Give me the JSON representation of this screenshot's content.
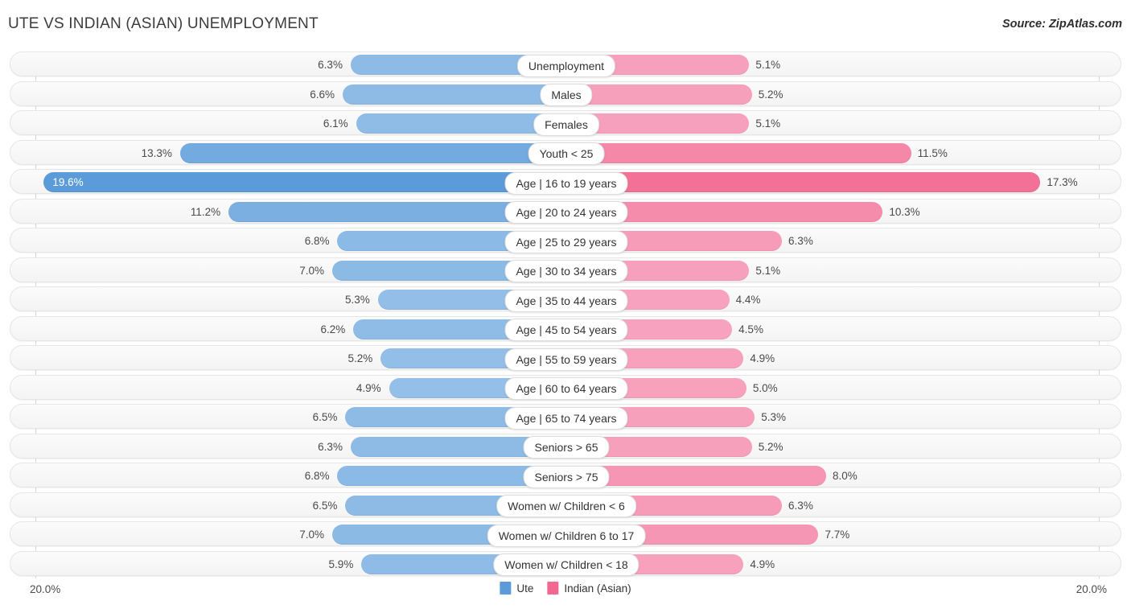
{
  "header": {
    "title": "UTE VS INDIAN (ASIAN) UNEMPLOYMENT",
    "source": "Source: ZipAtlas.com"
  },
  "axis": {
    "left_label": "20.0%",
    "right_label": "20.0%"
  },
  "legend": [
    {
      "label": "Ute",
      "color": "#5b9bd9"
    },
    {
      "label": "Indian (Asian)",
      "color": "#f2688f"
    }
  ],
  "chart_data": {
    "type": "bar",
    "title": "UTE VS INDIAN (ASIAN) UNEMPLOYMENT",
    "subtype": "diverging-bidirectional",
    "xlabel": "",
    "ylabel": "",
    "xlim": [
      20.0,
      20.0
    ],
    "grid": true,
    "legend_position": "bottom-center",
    "categories": [
      "Unemployment",
      "Males",
      "Females",
      "Youth < 25",
      "Age | 16 to 19 years",
      "Age | 20 to 24 years",
      "Age | 25 to 29 years",
      "Age | 30 to 34 years",
      "Age | 35 to 44 years",
      "Age | 45 to 54 years",
      "Age | 55 to 59 years",
      "Age | 60 to 64 years",
      "Age | 65 to 74 years",
      "Seniors > 65",
      "Seniors > 75",
      "Women w/ Children < 6",
      "Women w/ Children 6 to 17",
      "Women w/ Children < 18"
    ],
    "series": [
      {
        "name": "Ute",
        "side": "left",
        "color": "#95c0e8",
        "values": [
          6.3,
          6.6,
          6.1,
          13.3,
          19.6,
          11.2,
          6.8,
          7.0,
          5.3,
          6.2,
          5.2,
          4.9,
          6.5,
          6.3,
          6.8,
          6.5,
          7.0,
          5.9
        ],
        "labels": [
          "6.3%",
          "6.6%",
          "6.1%",
          "13.3%",
          "19.6%",
          "11.2%",
          "6.8%",
          "7.0%",
          "5.3%",
          "6.2%",
          "5.2%",
          "4.9%",
          "6.5%",
          "6.3%",
          "6.8%",
          "6.5%",
          "7.0%",
          "5.9%"
        ]
      },
      {
        "name": "Indian (Asian)",
        "side": "right",
        "color": "#f7a3bf",
        "values": [
          5.1,
          5.2,
          5.1,
          11.5,
          17.3,
          10.3,
          6.3,
          5.1,
          4.4,
          4.5,
          4.9,
          5.0,
          5.3,
          5.2,
          8.0,
          6.3,
          7.7,
          4.9
        ],
        "labels": [
          "5.1%",
          "5.2%",
          "5.1%",
          "11.5%",
          "17.3%",
          "10.3%",
          "6.3%",
          "5.1%",
          "4.4%",
          "4.5%",
          "4.9%",
          "5.0%",
          "5.3%",
          "5.2%",
          "8.0%",
          "6.3%",
          "7.7%",
          "4.9%"
        ]
      }
    ]
  },
  "colors": {
    "blue_light": "#95c0e8",
    "blue_mid": "#79aee0",
    "blue_dark": "#5b9bd9",
    "pink_light": "#f7a3bf",
    "pink_mid": "#f589a9",
    "pink_dark": "#f2688f",
    "row_bg": "#f6f6f6",
    "gridline": "#d8d8d8"
  }
}
